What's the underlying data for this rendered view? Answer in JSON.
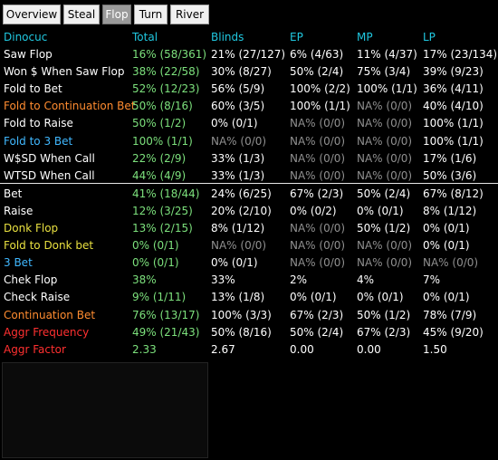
{
  "tabs": [
    {
      "label": "Overview",
      "active": false
    },
    {
      "label": "Steal",
      "active": false
    },
    {
      "label": "Flop",
      "active": true
    },
    {
      "label": "Turn",
      "active": false
    },
    {
      "label": "River",
      "active": false
    }
  ],
  "header": {
    "player": "Dinocuc",
    "total": "Total",
    "blinds": "Blinds",
    "ep": "EP",
    "mp": "MP",
    "lp": "LP"
  },
  "colors": {
    "header": "#20c8e0",
    "white": "#ffffff",
    "green": "#7ce07c",
    "yellow": "#e8e040",
    "orange": "#ff8c30",
    "blue": "#40b8ff",
    "red": "#ff3030",
    "gray": "#909090"
  },
  "rows": [
    {
      "label": "Saw Flop",
      "label_color": "white",
      "total": "16% (58/361)",
      "total_color": "green",
      "blinds": "21% (27/127)",
      "blinds_color": "white",
      "ep": "6% (4/63)",
      "ep_color": "white",
      "mp": "11% (4/37)",
      "mp_color": "white",
      "lp": "17% (23/134)",
      "lp_color": "white"
    },
    {
      "label": "Won $ When Saw Flop",
      "label_color": "white",
      "total": "38% (22/58)",
      "total_color": "green",
      "blinds": "30% (8/27)",
      "blinds_color": "white",
      "ep": "50% (2/4)",
      "ep_color": "white",
      "mp": "75% (3/4)",
      "mp_color": "white",
      "lp": "39% (9/23)",
      "lp_color": "white"
    },
    {
      "label": "Fold to Bet",
      "label_color": "white",
      "total": "52% (12/23)",
      "total_color": "green",
      "blinds": "56% (5/9)",
      "blinds_color": "white",
      "ep": "100% (2/2)",
      "ep_color": "white",
      "mp": "100% (1/1)",
      "mp_color": "white",
      "lp": "36% (4/11)",
      "lp_color": "white"
    },
    {
      "label": "Fold to Continuation Bet",
      "label_color": "orange",
      "total": "50% (8/16)",
      "total_color": "green",
      "blinds": "60% (3/5)",
      "blinds_color": "white",
      "ep": "100% (1/1)",
      "ep_color": "white",
      "mp": "NA% (0/0)",
      "mp_color": "gray",
      "lp": "40% (4/10)",
      "lp_color": "white"
    },
    {
      "label": "Fold to Raise",
      "label_color": "white",
      "total": "50% (1/2)",
      "total_color": "green",
      "blinds": "0% (0/1)",
      "blinds_color": "white",
      "ep": "NA% (0/0)",
      "ep_color": "gray",
      "mp": "NA% (0/0)",
      "mp_color": "gray",
      "lp": "100% (1/1)",
      "lp_color": "white"
    },
    {
      "label": "Fold to 3 Bet",
      "label_color": "blue",
      "total": "100% (1/1)",
      "total_color": "green",
      "blinds": "NA% (0/0)",
      "blinds_color": "gray",
      "ep": "NA% (0/0)",
      "ep_color": "gray",
      "mp": "NA% (0/0)",
      "mp_color": "gray",
      "lp": "100% (1/1)",
      "lp_color": "white"
    },
    {
      "label": "W$SD When Call",
      "label_color": "white",
      "total": "22% (2/9)",
      "total_color": "green",
      "blinds": "33% (1/3)",
      "blinds_color": "white",
      "ep": "NA% (0/0)",
      "ep_color": "gray",
      "mp": "NA% (0/0)",
      "mp_color": "gray",
      "lp": "17% (1/6)",
      "lp_color": "white"
    },
    {
      "label": "WTSD When Call",
      "label_color": "white",
      "total": "44% (4/9)",
      "total_color": "green",
      "blinds": "33% (1/3)",
      "blinds_color": "white",
      "ep": "NA% (0/0)",
      "ep_color": "gray",
      "mp": "NA% (0/0)",
      "mp_color": "gray",
      "lp": "50% (3/6)",
      "lp_color": "white"
    },
    {
      "label": "Bet",
      "label_color": "white",
      "total": "41% (18/44)",
      "total_color": "green",
      "blinds": "24% (6/25)",
      "blinds_color": "white",
      "ep": "67% (2/3)",
      "ep_color": "white",
      "mp": "50% (2/4)",
      "mp_color": "white",
      "lp": "67% (8/12)",
      "lp_color": "white"
    },
    {
      "label": "Raise",
      "label_color": "white",
      "total": "12% (3/25)",
      "total_color": "green",
      "blinds": "20% (2/10)",
      "blinds_color": "white",
      "ep": "0% (0/2)",
      "ep_color": "white",
      "mp": "0% (0/1)",
      "mp_color": "white",
      "lp": "8% (1/12)",
      "lp_color": "white"
    },
    {
      "label": "Donk Flop",
      "label_color": "yellow",
      "total": "13% (2/15)",
      "total_color": "green",
      "blinds": "8% (1/12)",
      "blinds_color": "white",
      "ep": "NA% (0/0)",
      "ep_color": "gray",
      "mp": "50% (1/2)",
      "mp_color": "white",
      "lp": "0% (0/1)",
      "lp_color": "white"
    },
    {
      "label": "Fold to Donk bet",
      "label_color": "yellow",
      "total": "0% (0/1)",
      "total_color": "green",
      "blinds": "NA% (0/0)",
      "blinds_color": "gray",
      "ep": "NA% (0/0)",
      "ep_color": "gray",
      "mp": "NA% (0/0)",
      "mp_color": "gray",
      "lp": "0% (0/1)",
      "lp_color": "white"
    },
    {
      "label": "3 Bet",
      "label_color": "blue",
      "total": "0% (0/1)",
      "total_color": "green",
      "blinds": "0% (0/1)",
      "blinds_color": "white",
      "ep": "NA% (0/0)",
      "ep_color": "gray",
      "mp": "NA% (0/0)",
      "mp_color": "gray",
      "lp": "NA% (0/0)",
      "lp_color": "gray"
    },
    {
      "label": "Chek Flop",
      "label_color": "white",
      "total": "38%",
      "total_color": "green",
      "blinds": "33%",
      "blinds_color": "white",
      "ep": "2%",
      "ep_color": "white",
      "mp": "4%",
      "mp_color": "white",
      "lp": "7%",
      "lp_color": "white"
    },
    {
      "label": "Check Raise",
      "label_color": "white",
      "total": "9% (1/11)",
      "total_color": "green",
      "blinds": "13% (1/8)",
      "blinds_color": "white",
      "ep": "0% (0/1)",
      "ep_color": "white",
      "mp": "0% (0/1)",
      "mp_color": "white",
      "lp": "0% (0/1)",
      "lp_color": "white"
    },
    {
      "label": "Continuation Bet",
      "label_color": "orange",
      "total": "76% (13/17)",
      "total_color": "green",
      "blinds": "100% (3/3)",
      "blinds_color": "white",
      "ep": "67% (2/3)",
      "ep_color": "white",
      "mp": "50% (1/2)",
      "mp_color": "white",
      "lp": "78% (7/9)",
      "lp_color": "white"
    },
    {
      "label": "Aggr Frequency",
      "label_color": "red",
      "total": "49% (21/43)",
      "total_color": "green",
      "blinds": "50% (8/16)",
      "blinds_color": "white",
      "ep": "50% (2/4)",
      "ep_color": "white",
      "mp": "67% (2/3)",
      "mp_color": "white",
      "lp": "45% (9/20)",
      "lp_color": "white"
    },
    {
      "label": "Aggr Factor",
      "label_color": "red",
      "total": "2.33",
      "total_color": "green",
      "blinds": "2.67",
      "blinds_color": "white",
      "ep": "0.00",
      "ep_color": "white",
      "mp": "0.00",
      "mp_color": "white",
      "lp": "1.50",
      "lp_color": "white"
    }
  ]
}
